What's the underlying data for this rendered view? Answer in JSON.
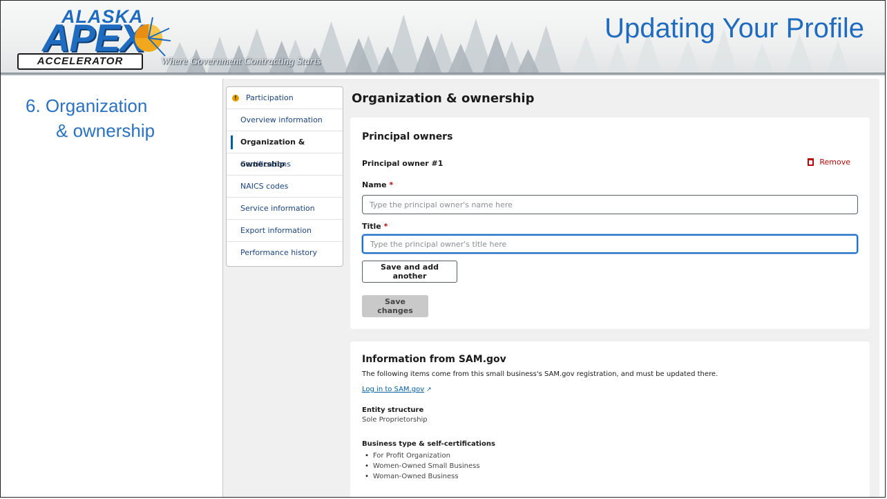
{
  "header": {
    "logo_alaska": "ALASKA",
    "logo_apex": "APEX",
    "logo_accelerator": "ACCELERATOR",
    "tagline": "Where Government Contracting Starts",
    "title": "Updating Your Profile",
    "brand_blue": "#1f6bbf"
  },
  "step": {
    "line1": "6. Organization",
    "line2": "& ownership"
  },
  "sidebar": {
    "items": [
      {
        "label": "Participation",
        "icon": "warning-icon"
      },
      {
        "label": "Overview information"
      },
      {
        "label": "Organization & ownership",
        "active": true
      },
      {
        "label": "Certifications"
      },
      {
        "label": "NAICS codes"
      },
      {
        "label": "Service information"
      },
      {
        "label": "Export information"
      },
      {
        "label": "Performance history"
      }
    ]
  },
  "main": {
    "title": "Organization & ownership",
    "principal": {
      "heading": "Principal owners",
      "owner_label": "Principal owner #1",
      "remove_label": "Remove",
      "name_label": "Name",
      "name_placeholder": "Type the principal owner's name here",
      "title_label": "Title",
      "title_placeholder": "Type the principal owner's title here",
      "required_mark": "*",
      "save_add_label": "Save and add another",
      "save_changes_label": "Save changes"
    },
    "sam": {
      "heading": "Information from SAM.gov",
      "description": "The following items come from this small business's SAM.gov registration, and must be updated there.",
      "link_label": "Log in to SAM.gov",
      "entity_label": "Entity structure",
      "entity_value": "Sole Proprietorship",
      "business_label": "Business type & self-certifications",
      "business_items": [
        "For Profit Organization",
        "Women-Owned Small Business",
        "Woman-Owned Business"
      ]
    }
  },
  "colors": {
    "link": "#005ea2",
    "danger": "#b50909",
    "warning": "#e5a000",
    "focus": "#2470c9"
  }
}
